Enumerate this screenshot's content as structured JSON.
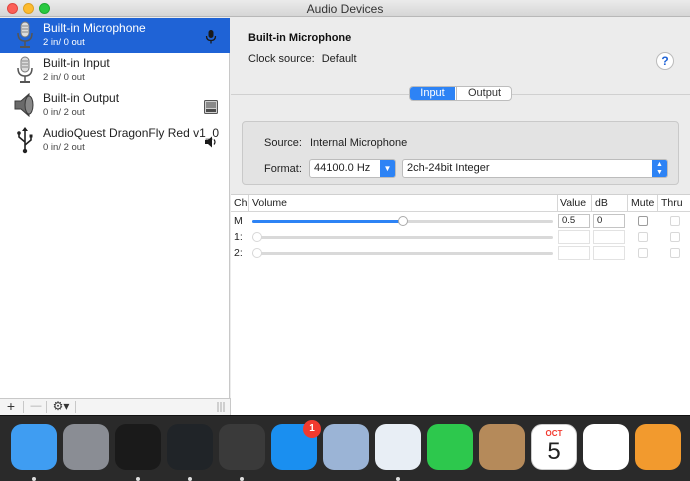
{
  "window": {
    "title": "Audio Devices"
  },
  "devices": [
    {
      "name": "Built-in Microphone",
      "sub": "2 in/ 0 out",
      "icon": "microphone-icon",
      "badge": "microphone-badge-icon",
      "selected": true
    },
    {
      "name": "Built-in Input",
      "sub": "2 in/ 0 out",
      "icon": "microphone-icon",
      "badge": "",
      "selected": false
    },
    {
      "name": "Built-in Output",
      "sub": "0 in/ 2 out",
      "icon": "speaker-icon",
      "badge": "finder-badge-icon",
      "selected": false
    },
    {
      "name": "AudioQuest DragonFly Red v1_0",
      "sub": "0 in/ 2 out",
      "icon": "usb-icon",
      "badge": "speaker-badge-icon",
      "selected": false
    }
  ],
  "sidebar_footer": {
    "add": "+",
    "remove": "—",
    "gear": "⚙▾"
  },
  "detail": {
    "title": "Built-in Microphone",
    "clock_label": "Clock source:",
    "clock_value": "Default",
    "help": "?",
    "tabs": [
      "Input",
      "Output"
    ],
    "active_tab": "Input",
    "source_label": "Source:",
    "source_value": "Internal Microphone",
    "format_label": "Format:",
    "sample_rate": "44100.0 Hz",
    "bit_format": "2ch-24bit Integer"
  },
  "channel_table": {
    "headers": {
      "ch": "Ch",
      "volume": "Volume",
      "value": "Value",
      "db": "dB",
      "mute": "Mute",
      "thru": "Thru"
    },
    "rows": [
      {
        "ch": "M",
        "level": 0.5,
        "value": "0.5",
        "db": "0",
        "enabled": true
      },
      {
        "ch": "1:",
        "level": 0,
        "value": "",
        "db": "",
        "enabled": false
      },
      {
        "ch": "2:",
        "level": 0,
        "value": "",
        "db": "",
        "enabled": false
      }
    ]
  },
  "dock": {
    "apps": [
      {
        "name": "finder-icon",
        "color": "#3f9df2",
        "running": true
      },
      {
        "name": "launchpad-icon",
        "color": "#8a8d94",
        "running": false
      },
      {
        "name": "piano-icon",
        "color": "#1a1a1a",
        "running": true
      },
      {
        "name": "audio-app-icon",
        "color": "#202428",
        "running": true
      },
      {
        "name": "monitor-app-icon",
        "color": "#3a3a3a",
        "running": true
      },
      {
        "name": "app-store-icon",
        "color": "#1a8ff0",
        "running": false,
        "badge": "1"
      },
      {
        "name": "mail-stamp-icon",
        "color": "#9bb4d6",
        "running": false
      },
      {
        "name": "safari-icon",
        "color": "#e8eef5",
        "running": true
      },
      {
        "name": "facetime-icon",
        "color": "#2dc84d",
        "running": false
      },
      {
        "name": "contacts-icon",
        "color": "#b58a5a",
        "running": false
      },
      {
        "name": "calendar-icon",
        "color": "#ffffff",
        "running": false,
        "month": "OCT",
        "day": "5"
      },
      {
        "name": "itunes-icon",
        "color": "#ffffff",
        "running": false
      },
      {
        "name": "ibooks-icon",
        "color": "#f29a2e",
        "running": false
      }
    ]
  }
}
